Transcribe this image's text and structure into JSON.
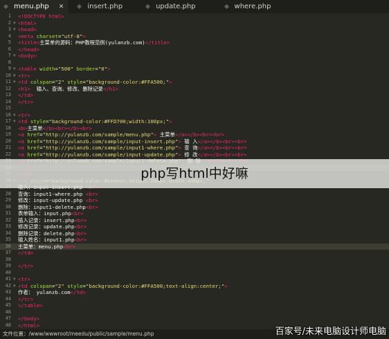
{
  "tabs": [
    {
      "label": "menu.php",
      "close": "✕",
      "active": true
    },
    {
      "label": "insert.php",
      "active": false
    },
    {
      "label": "update.php",
      "active": false
    },
    {
      "label": "where.php",
      "active": false
    }
  ],
  "code_lines": [
    {
      "n": "1",
      "t": [
        [
          "tg",
          "<!DOCTYPE html>"
        ]
      ]
    },
    {
      "n": "2",
      "f": "▼",
      "t": [
        [
          "tg",
          "<html>"
        ]
      ]
    },
    {
      "n": "3",
      "f": "▼",
      "t": [
        [
          "tg",
          "<head>"
        ]
      ]
    },
    {
      "n": "4",
      "t": [
        [
          "tg",
          "<meta "
        ],
        [
          "at",
          "charset"
        ],
        [
          "pl",
          "="
        ],
        [
          "st",
          "\"utf-8\""
        ],
        [
          "tg",
          ">"
        ]
      ]
    },
    {
      "n": "5",
      "t": [
        [
          "tg",
          "<title>"
        ],
        [
          "pl",
          "主菜单的源码：PHP教程范例(yulanzb.com)"
        ],
        [
          "tg",
          "</title>"
        ]
      ]
    },
    {
      "n": "6",
      "t": [
        [
          "tg",
          "</head>"
        ]
      ]
    },
    {
      "n": "7",
      "f": "▼",
      "t": [
        [
          "tg",
          "<body>"
        ]
      ]
    },
    {
      "n": "8",
      "t": []
    },
    {
      "n": "9",
      "f": "▼",
      "t": [
        [
          "tg",
          "<table "
        ],
        [
          "at",
          "width"
        ],
        [
          "pl",
          "="
        ],
        [
          "st",
          "\"500\" "
        ],
        [
          "at",
          "border"
        ],
        [
          "pl",
          "="
        ],
        [
          "st",
          "\"0\""
        ],
        [
          "tg",
          ">"
        ]
      ]
    },
    {
      "n": "10",
      "f": "▼",
      "t": [
        [
          "tg",
          "<tr>"
        ]
      ]
    },
    {
      "n": "11",
      "f": "▼",
      "t": [
        [
          "tg",
          "<td "
        ],
        [
          "at",
          "colspan"
        ],
        [
          "pl",
          "="
        ],
        [
          "st",
          "\"2\" "
        ],
        [
          "at",
          "style"
        ],
        [
          "pl",
          "="
        ],
        [
          "st",
          "\"background-color:#FFA500;\""
        ],
        [
          "tg",
          ">"
        ]
      ]
    },
    {
      "n": "12",
      "t": [
        [
          "tg",
          "<h1>"
        ],
        [
          "pl",
          "  输入、查询、修改、删除记录"
        ],
        [
          "tg",
          "</h1>"
        ]
      ]
    },
    {
      "n": "13",
      "t": [
        [
          "tg",
          "</td>"
        ]
      ]
    },
    {
      "n": "14",
      "t": [
        [
          "tg",
          "</tr>"
        ]
      ]
    },
    {
      "n": "15",
      "t": []
    },
    {
      "n": "16",
      "f": "▼",
      "t": [
        [
          "tg",
          "<tr>"
        ]
      ]
    },
    {
      "n": "17",
      "f": "▼",
      "t": [
        [
          "tg",
          "<td "
        ],
        [
          "at",
          "style"
        ],
        [
          "pl",
          "="
        ],
        [
          "st",
          "\"background-color:#FFD700;width:100px;\""
        ],
        [
          "tg",
          ">"
        ]
      ]
    },
    {
      "n": "18",
      "t": [
        [
          "tg",
          "<b>"
        ],
        [
          "pl",
          "主菜单"
        ],
        [
          "tg",
          "</b><br></b><br>"
        ]
      ]
    },
    {
      "n": "19",
      "t": [
        [
          "tg",
          "<a "
        ],
        [
          "at",
          "href"
        ],
        [
          "pl",
          "="
        ],
        [
          "st",
          "\"http://yulanzb.com/sample/menu.php\""
        ],
        [
          "tg",
          ">"
        ],
        [
          "pl",
          " 主菜单"
        ],
        [
          "tg",
          "</a></b><br><br>"
        ]
      ]
    },
    {
      "n": "20",
      "t": [
        [
          "tg",
          "<a "
        ],
        [
          "at",
          "href"
        ],
        [
          "pl",
          "="
        ],
        [
          "st",
          "\"http://yulanzb.com/sample/input-insert.php\""
        ],
        [
          "tg",
          ">"
        ],
        [
          "pl",
          " 输 入"
        ],
        [
          "tg",
          "</a></b><br><br>"
        ]
      ]
    },
    {
      "n": "21",
      "t": [
        [
          "tg",
          "<a "
        ],
        [
          "at",
          "href"
        ],
        [
          "pl",
          "="
        ],
        [
          "st",
          "\"http://yulanzb.com/sample/input1-where.php\""
        ],
        [
          "tg",
          ">"
        ],
        [
          "pl",
          " 查 询"
        ],
        [
          "tg",
          "</a></b><br><br>"
        ]
      ]
    },
    {
      "n": "22",
      "t": [
        [
          "tg",
          "<a "
        ],
        [
          "at",
          "href"
        ],
        [
          "pl",
          "="
        ],
        [
          "st",
          "\"http://yulanzb.com/sample/input-update.php\""
        ],
        [
          "tg",
          ">"
        ],
        [
          "pl",
          " 修 改"
        ],
        [
          "tg",
          "</a></b><br><br>"
        ]
      ]
    },
    {
      "n": "23",
      "t": [
        [
          "tg",
          "<a "
        ],
        [
          "at",
          "href"
        ],
        [
          "pl",
          "="
        ],
        [
          "st",
          "\"http://yulanzb.com/sample/input1-delete.php\""
        ],
        [
          "tg",
          ">"
        ],
        [
          "pl",
          " 删 除"
        ],
        [
          "tg",
          "</a></b><br><br>"
        ]
      ]
    },
    {
      "n": "24",
      "t": []
    },
    {
      "n": "25",
      "t": [
        [
          "tg",
          "</td>"
        ]
      ]
    },
    {
      "n": "26",
      "f": "▼",
      "t": [
        [
          "tg",
          "<td "
        ],
        [
          "at",
          "style"
        ],
        [
          "pl",
          "="
        ],
        [
          "st",
          "\"background-color:#eeeeee;height:200px;width:400px;\""
        ],
        [
          "tg",
          ">"
        ]
      ]
    },
    {
      "n": "27",
      "t": [
        [
          "pl",
          "输入：input-insert.php "
        ],
        [
          "tg",
          "<br>"
        ]
      ]
    },
    {
      "n": "28",
      "t": [
        [
          "pl",
          "查询：input1-where.php "
        ],
        [
          "tg",
          "<br>"
        ]
      ]
    },
    {
      "n": "29",
      "t": [
        [
          "pl",
          "修改：input-update.php "
        ],
        [
          "tg",
          "<br>"
        ]
      ]
    },
    {
      "n": "30",
      "t": [
        [
          "pl",
          "删除：input1-delete.php"
        ],
        [
          "tg",
          "<br>"
        ]
      ]
    },
    {
      "n": "31",
      "t": [
        [
          "pl",
          "表单输入：input.php"
        ],
        [
          "tg",
          "<br>"
        ]
      ]
    },
    {
      "n": "32",
      "t": [
        [
          "pl",
          "插入记录：insert.php"
        ],
        [
          "tg",
          "<br>"
        ]
      ]
    },
    {
      "n": "33",
      "t": [
        [
          "pl",
          "修改记录：update.php"
        ],
        [
          "tg",
          "<br>"
        ]
      ]
    },
    {
      "n": "34",
      "t": [
        [
          "pl",
          "删除记录：delete.php"
        ],
        [
          "tg",
          "<br>"
        ]
      ]
    },
    {
      "n": "35",
      "t": [
        [
          "pl",
          "输入姓名：input1.php"
        ],
        [
          "tg",
          "<br>"
        ]
      ]
    },
    {
      "n": "36",
      "t": [
        [
          "pl",
          "主菜单：menu.php"
        ],
        [
          "tg",
          "<br>"
        ]
      ]
    },
    {
      "n": "37",
      "t": [
        [
          "tg",
          "</td>"
        ]
      ]
    },
    {
      "n": "38",
      "t": []
    },
    {
      "n": "39",
      "t": [
        [
          "tg",
          "</tr>"
        ]
      ]
    },
    {
      "n": "40",
      "t": []
    },
    {
      "n": "41",
      "f": "▼",
      "t": [
        [
          "tg",
          "<tr>"
        ]
      ]
    },
    {
      "n": "42",
      "f": "▼",
      "t": [
        [
          "tg",
          "<td "
        ],
        [
          "at",
          "colspan"
        ],
        [
          "pl",
          "="
        ],
        [
          "st",
          "\"2\" "
        ],
        [
          "at",
          "style"
        ],
        [
          "pl",
          "="
        ],
        [
          "st",
          "\"background-color:#FFA500;text-align:center;\""
        ],
        [
          "tg",
          ">"
        ]
      ]
    },
    {
      "n": "43",
      "t": [
        [
          "pl",
          "作者： yulanzb.com"
        ],
        [
          "tg",
          "</td>"
        ]
      ]
    },
    {
      "n": "44",
      "t": [
        [
          "tg",
          "</tr>"
        ]
      ]
    },
    {
      "n": "45",
      "t": [
        [
          "tg",
          "</table>"
        ]
      ]
    },
    {
      "n": "46",
      "t": []
    },
    {
      "n": "47",
      "t": [
        [
          "tg",
          "</body>"
        ]
      ]
    },
    {
      "n": "48",
      "t": [
        [
          "tg",
          "</html>"
        ]
      ]
    }
  ],
  "highlight_line": "36",
  "selection_lines": [
    "24"
  ],
  "overlay_caption": "php写html中好嘛",
  "status": {
    "text": "文件位置：/www/wwwroot/meedu/public/sample/menu.php"
  },
  "watermark": "百家号/未来电脑设计师电脑"
}
